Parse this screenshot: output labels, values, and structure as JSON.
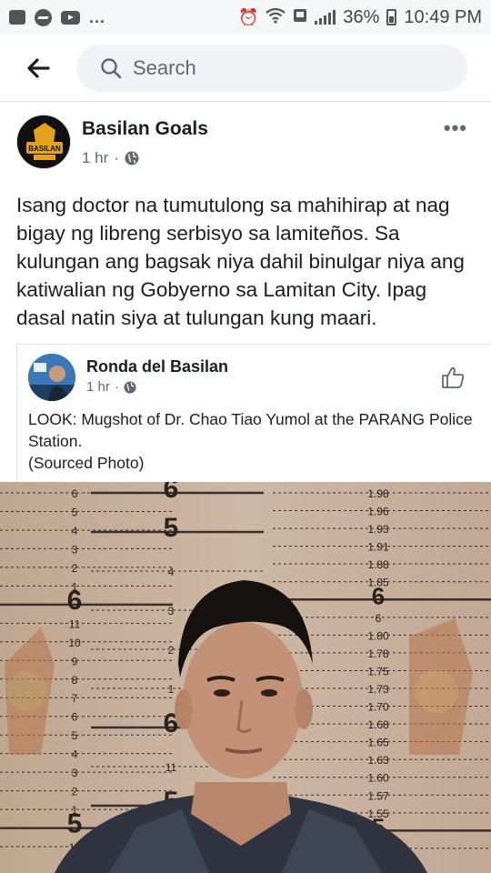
{
  "status_bar": {
    "dots": "...",
    "battery": "36%",
    "time": "10:49 PM"
  },
  "search": {
    "placeholder": "Search"
  },
  "post": {
    "author": "Basilan Goals",
    "avatar_text": "BASILAN",
    "time": "1 hr",
    "separator": "·",
    "more": "•••",
    "text": "Isang doctor na tumutulong sa mahihirap at nag bigay ng libreng serbisyo sa lamiteños. Sa kulungan ang bagsak niya dahil binulgar niya ang katiwalian ng Gobyerno sa Lamitan City. Ipag dasal natin siya at tulungan kung maari."
  },
  "shared_post": {
    "author": "Ronda del Basilan",
    "time": "1 hr",
    "separator": "·",
    "text_line1": "LOOK: Mugshot of Dr. Chao Tiao Yumol  at the PARANG Police Station.",
    "text_line2": "(Sourced Photo)"
  },
  "photo": {
    "height_marks_left": [
      "6",
      "5",
      "4",
      "3",
      "2",
      "1",
      "6",
      "11",
      "10",
      "9",
      "8",
      "7",
      "6",
      "5",
      "4",
      "3",
      "2",
      "1",
      "5",
      "11"
    ],
    "height_marks_mid": [
      "6",
      "5",
      "4",
      "3",
      "2",
      "1",
      "6",
      "11",
      "5"
    ],
    "height_marks_right": [
      "1.98",
      "1.96",
      "1.93",
      "1.91",
      "1.88",
      "1.85",
      "6",
      "6",
      "1.80",
      "1.78",
      "1.75",
      "1.73",
      "1.70",
      "1.68",
      "1.65",
      "1.63",
      "1.60",
      "1.57",
      "1.55",
      "5",
      "1.50"
    ]
  }
}
